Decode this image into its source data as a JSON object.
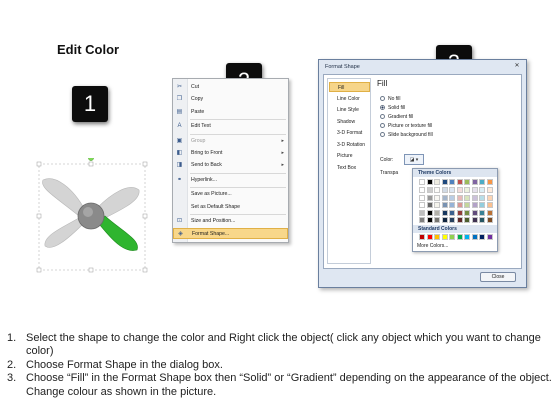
{
  "title": "Edit Color",
  "steps": [
    "1",
    "2",
    "3"
  ],
  "context_menu": {
    "items": [
      {
        "icon": "scissors-icon",
        "glyph": "✂",
        "label": "Cut",
        "disabled": false,
        "submenu": false
      },
      {
        "icon": "copy-icon",
        "glyph": "❐",
        "label": "Copy",
        "disabled": false,
        "submenu": false
      },
      {
        "icon": "paste-icon",
        "glyph": "▤",
        "label": "Paste",
        "disabled": false,
        "submenu": false
      },
      {
        "icon": "edit-text-icon",
        "glyph": "A",
        "label": "Edit Text",
        "disabled": false,
        "submenu": false
      },
      {
        "icon": "group-icon",
        "glyph": "▣",
        "label": "Group",
        "disabled": true,
        "submenu": true
      },
      {
        "icon": "bring-to-front-icon",
        "glyph": "◧",
        "label": "Bring to Front",
        "disabled": false,
        "submenu": true
      },
      {
        "icon": "send-to-back-icon",
        "glyph": "◨",
        "label": "Send to Back",
        "disabled": false,
        "submenu": true
      },
      {
        "icon": "hyperlink-icon",
        "glyph": "⚭",
        "label": "Hyperlink...",
        "disabled": false,
        "submenu": false
      },
      {
        "icon": "",
        "glyph": "",
        "label": "Save as Picture...",
        "disabled": false,
        "submenu": false
      },
      {
        "icon": "",
        "glyph": "",
        "label": "Set as Default Shape",
        "disabled": false,
        "submenu": false
      },
      {
        "icon": "size-position-icon",
        "glyph": "⊡",
        "label": "Size and Position...",
        "disabled": false,
        "submenu": false
      },
      {
        "icon": "format-shape-icon",
        "glyph": "◈",
        "label": "Format Shape...",
        "disabled": false,
        "submenu": false,
        "highlight": true
      }
    ]
  },
  "dialog": {
    "title": "Format Shape",
    "nav": [
      "Fill",
      "Line Color",
      "Line Style",
      "Shadow",
      "3-D Format",
      "3-D Rotation",
      "Picture",
      "Text Box"
    ],
    "fill_heading": "Fill",
    "options": [
      "No fill",
      "Solid fill",
      "Gradient fill",
      "Picture or texture fill",
      "Slide background fill"
    ],
    "selected_option": 1,
    "color_label": "Color:",
    "transparency_label": "Transpa",
    "theme_colors_label": "Theme Colors",
    "standard_colors_label": "Standard Colors",
    "more_colors_label": "More Colors...",
    "close_label": "Close"
  },
  "colors": {
    "theme_top": [
      "#ffffff",
      "#000000",
      "#eeece1",
      "#1f497d",
      "#4f81bd",
      "#c0504d",
      "#9bbb59",
      "#8064a2",
      "#4bacc6",
      "#f79646"
    ],
    "standard": [
      "#c00000",
      "#ff0000",
      "#ffc000",
      "#ffff00",
      "#92d050",
      "#00b050",
      "#00b0f0",
      "#0070c0",
      "#002060",
      "#7030a0"
    ],
    "fan_blade": "#d4d4d4",
    "fan_blade_selected": "#2fb52f",
    "fan_hub": "#8a8a8a"
  },
  "instructions": [
    {
      "num": "1.",
      "text": "Select the shape to change the color and Right click the object( click any object which you want to change color)"
    },
    {
      "num": "2.",
      "text": "Choose Format Shape in the dialog box."
    },
    {
      "num": "3.",
      "text": "Choose “Fill” in the Format Shape box then “Solid” or “Gradient” depending on the appearance of the object. Change colour as shown in the picture."
    }
  ]
}
